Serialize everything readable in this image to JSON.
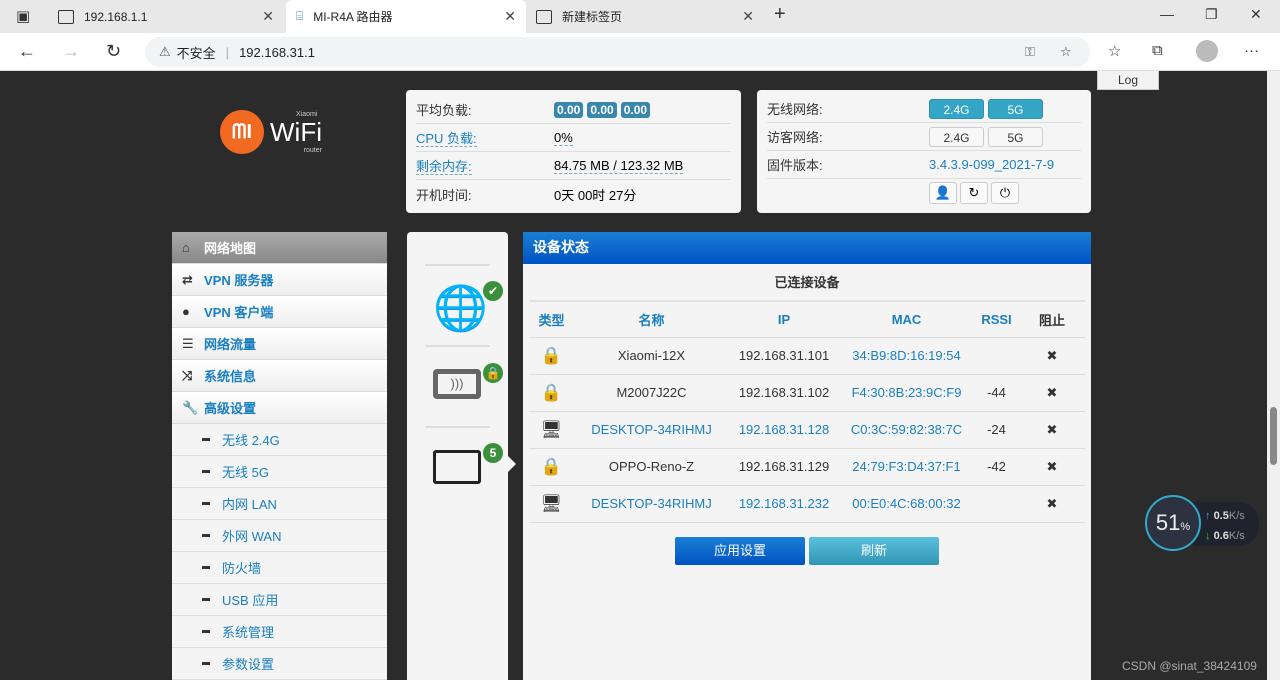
{
  "browser": {
    "tabs": [
      {
        "title": "192.168.1.1"
      },
      {
        "title": "MI-R4A 路由器"
      },
      {
        "title": "新建标签页"
      }
    ],
    "insecure": "不安全",
    "url": "192.168.31.1"
  },
  "log_label": "Log",
  "logo": {
    "brand": "WiFi",
    "top": "Xiaomi",
    "bottom": "router",
    "mark": "MI"
  },
  "status": {
    "rows": [
      {
        "k": "平均负载:",
        "badges": [
          "0.00",
          "0.00",
          "0.00"
        ]
      },
      {
        "k": "CPU 负载:",
        "v": "0%"
      },
      {
        "k": "剩余内存:",
        "v": "84.75 MB / 123.32 MB"
      },
      {
        "k": "开机时间:",
        "v": "0天 00时 27分"
      }
    ]
  },
  "wireless": {
    "wifi_label": "无线网络:",
    "guest_label": "访客网络:",
    "fw_label": "固件版本:",
    "fw": "3.4.3.9-099_2021-7-9",
    "b24": "2.4G",
    "b5": "5G"
  },
  "sidebar": {
    "items": [
      {
        "label": "网络地图"
      },
      {
        "label": "VPN 服务器"
      },
      {
        "label": "VPN 客户端"
      },
      {
        "label": "网络流量"
      },
      {
        "label": "系统信息"
      },
      {
        "label": "高级设置"
      }
    ],
    "subs": [
      {
        "label": "无线 2.4G"
      },
      {
        "label": "无线 5G"
      },
      {
        "label": "内网 LAN"
      },
      {
        "label": "外网 WAN"
      },
      {
        "label": "防火墙"
      },
      {
        "label": "USB 应用"
      },
      {
        "label": "系统管理"
      },
      {
        "label": "参数设置"
      }
    ]
  },
  "clients_badge": "5",
  "devices": {
    "title": "设备状态",
    "subtitle": "已连接设备",
    "headers": [
      "类型",
      "名称",
      "IP",
      "MAC",
      "RSSI",
      "阻止"
    ],
    "rows": [
      {
        "type": "lock",
        "name": "Xiaomi-12X",
        "ip": "192.168.31.101",
        "mac": "34:B9:8D:16:19:54",
        "rssi": "",
        "wired": false
      },
      {
        "type": "lock",
        "name": "M2007J22C",
        "ip": "192.168.31.102",
        "mac": "F4:30:8B:23:9C:F9",
        "rssi": "-44",
        "wired": false
      },
      {
        "type": "desktop",
        "name": "DESKTOP-34RIHMJ",
        "ip": "192.168.31.128",
        "mac": "C0:3C:59:82:38:7C",
        "rssi": "-24",
        "wired": true
      },
      {
        "type": "lock",
        "name": "OPPO-Reno-Z",
        "ip": "192.168.31.129",
        "mac": "24:79:F3:D4:37:F1",
        "rssi": "-42",
        "wired": false
      },
      {
        "type": "desktop",
        "name": "DESKTOP-34RIHMJ",
        "ip": "192.168.31.232",
        "mac": "00:E0:4C:68:00:32",
        "rssi": "",
        "wired": true
      }
    ],
    "apply": "应用设置",
    "refresh": "刷新"
  },
  "widget": {
    "percent": "51",
    "unit": "%",
    "up": "0.5",
    "down": "0.6",
    "rate_unit": "K/s"
  },
  "watermark": "CSDN @sinat_38424109"
}
